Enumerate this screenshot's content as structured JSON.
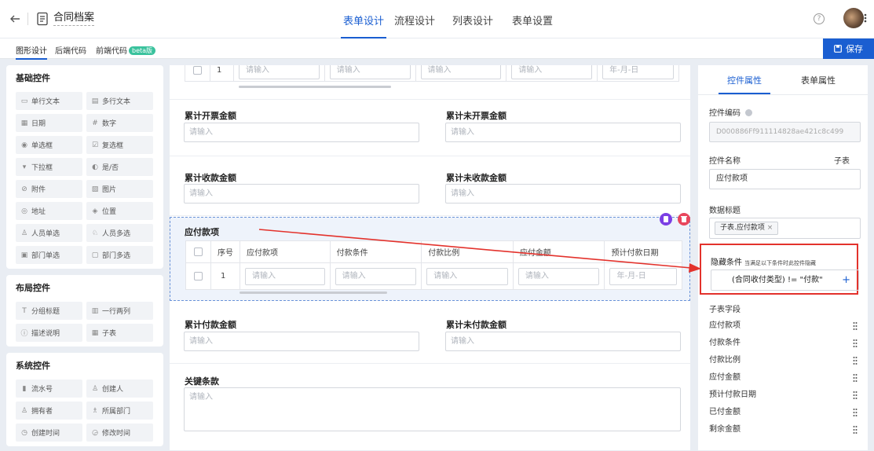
{
  "app": {
    "title": "合同档案"
  },
  "nav": {
    "tabs": [
      "表单设计",
      "流程设计",
      "列表设计",
      "表单设置"
    ],
    "active_tab": "表单设计"
  },
  "subnav": {
    "tabs": [
      "图形设计",
      "后端代码",
      "前端代码"
    ],
    "beta": "beta版",
    "save_label": "保存"
  },
  "palette": {
    "groups": [
      {
        "title": "基础控件",
        "items": [
          {
            "icon": "single-line-text-icon",
            "label": "单行文本"
          },
          {
            "icon": "multi-line-text-icon",
            "label": "多行文本"
          },
          {
            "icon": "date-icon",
            "label": "日期"
          },
          {
            "icon": "number-icon",
            "label": "数字"
          },
          {
            "icon": "radio-icon",
            "label": "单选框"
          },
          {
            "icon": "checkbox-icon",
            "label": "复选框"
          },
          {
            "icon": "dropdown-icon",
            "label": "下拉框"
          },
          {
            "icon": "toggle-icon",
            "label": "是/否"
          },
          {
            "icon": "attachment-icon",
            "label": "附件"
          },
          {
            "icon": "image-icon",
            "label": "图片"
          },
          {
            "icon": "address-icon",
            "label": "地址"
          },
          {
            "icon": "location-icon",
            "label": "位置"
          },
          {
            "icon": "person-icon",
            "label": "人员单选"
          },
          {
            "icon": "people-icon",
            "label": "人员多选"
          },
          {
            "icon": "department-icon",
            "label": "部门单选"
          },
          {
            "icon": "departments-icon",
            "label": "部门多选"
          }
        ]
      },
      {
        "title": "布局控件",
        "items": [
          {
            "icon": "group-title-icon",
            "label": "分组标题"
          },
          {
            "icon": "two-column-icon",
            "label": "一行两列"
          },
          {
            "icon": "description-icon",
            "label": "描述说明"
          },
          {
            "icon": "subtable-icon",
            "label": "子表"
          }
        ]
      },
      {
        "title": "系统控件",
        "items": [
          {
            "icon": "serial-number-icon",
            "label": "流水号"
          },
          {
            "icon": "creator-icon",
            "label": "创建人"
          },
          {
            "icon": "owner-icon",
            "label": "拥有者"
          },
          {
            "icon": "owner-department-icon",
            "label": "所属部门"
          },
          {
            "icon": "created-time-icon",
            "label": "创建时间"
          },
          {
            "icon": "modified-time-icon",
            "label": "修改时间"
          }
        ]
      }
    ]
  },
  "form": {
    "top_table": {
      "row_no": "1",
      "placeholders": [
        "请输入",
        "请输入",
        "请输入",
        "请输入"
      ],
      "date_placeholder": "年-月-日"
    },
    "fields": [
      {
        "label": "累计开票金额",
        "placeholder": "请输入"
      },
      {
        "label": "累计未开票金额",
        "placeholder": "请输入"
      },
      {
        "label": "累计收款金额",
        "placeholder": "请输入"
      },
      {
        "label": "累计未收款金额",
        "placeholder": "请输入"
      },
      {
        "label": "累计付款金额",
        "placeholder": "请输入"
      },
      {
        "label": "累计未付款金额",
        "placeholder": "请输入"
      }
    ],
    "subtable": {
      "title": "应付款项",
      "columns": [
        "序号",
        "应付款项",
        "付款条件",
        "付款比例",
        "应付金额",
        "预计付款日期"
      ],
      "row_no": "1",
      "placeholder": "请输入",
      "date_placeholder": "年-月-日"
    },
    "key_terms": {
      "label": "关键条款",
      "placeholder": "请输入"
    }
  },
  "props": {
    "tabs": [
      "控件属性",
      "表单属性"
    ],
    "code_label": "控件编码",
    "code_value": "D000886Ff911114828ae421c8c499",
    "name_label": "控件名称",
    "name_tag": "子表",
    "name_value": "应付款项",
    "data_title_label": "数据标题",
    "data_title_chip": "子表.应付款项",
    "hide_label": "隐藏条件",
    "hide_hint": "当满足以下条件时此控件隐藏",
    "hide_condition": "(合同收付类型) != \"付款\"",
    "subfields_label": "子表字段",
    "subfields": [
      "应付款项",
      "付款条件",
      "付款比例",
      "应付金额",
      "预计付款日期",
      "已付金额",
      "剩余金额"
    ]
  },
  "colors": {
    "accent": "#1a5ed1",
    "annotation": "#e3322c",
    "delete": "#e8465c",
    "copy": "#7b3fe4"
  }
}
